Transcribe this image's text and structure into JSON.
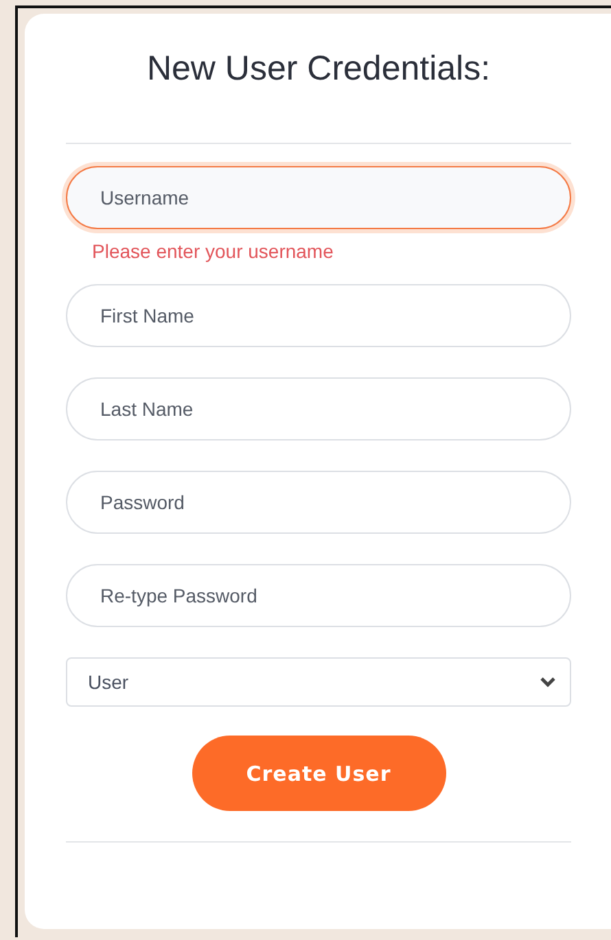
{
  "title": "New User Credentials:",
  "fields": [
    {
      "placeholder": "Username",
      "focused": true,
      "error": "Please enter your username"
    },
    {
      "placeholder": "First Name",
      "focused": false
    },
    {
      "placeholder": "Last Name",
      "focused": false
    },
    {
      "placeholder": "Password",
      "focused": false
    },
    {
      "placeholder": "Re-type Password",
      "focused": false
    }
  ],
  "role_select": {
    "value": "User"
  },
  "submit_button": {
    "label": "Create User"
  }
}
